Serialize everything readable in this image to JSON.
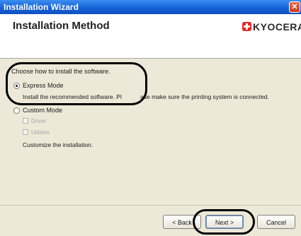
{
  "window": {
    "title": "Installation Wizard",
    "close_glyph": "✕"
  },
  "header": {
    "page_title": "Installation Method",
    "brand_name": "KYOCERA"
  },
  "main": {
    "prompt": "Choose how to install the software.",
    "express": {
      "label": "Express Mode",
      "description_part1": "Install the recommended software. Pl",
      "description_part2": "ase make sure the printing system is connected."
    },
    "custom": {
      "label": "Custom Mode",
      "options": [
        "Driver",
        "Utilities"
      ],
      "description": "Customize the installation."
    }
  },
  "buttons": {
    "back": "< Back",
    "next": "Next >",
    "cancel": "Cancel"
  },
  "colors": {
    "titlebar": "#1762d8",
    "brand_red": "#e52521",
    "dialog_bg": "#ece9d8"
  }
}
